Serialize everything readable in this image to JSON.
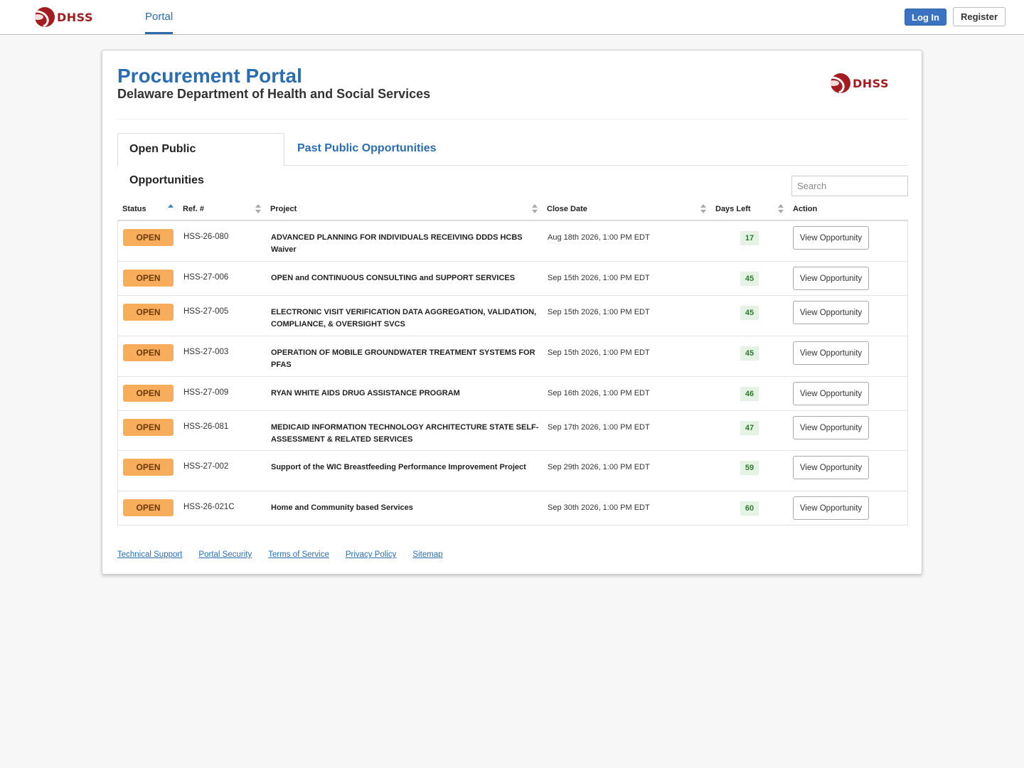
{
  "topnav": {
    "brand": "DHSS",
    "tab": "Portal",
    "login_label": "Log In",
    "register_label": "Register"
  },
  "header": {
    "title": "Procurement Portal",
    "subtitle": "Delaware Department of Health and Social Services",
    "brand": "DHSS"
  },
  "tabs": {
    "open": "Open Public Opportunities",
    "past": "Past Public Opportunities"
  },
  "search": {
    "placeholder": "Search"
  },
  "table": {
    "headers": {
      "status": "Status",
      "ref": "Ref. #",
      "project": "Project",
      "close_date": "Close Date",
      "days_left": "Days Left",
      "action": "Action"
    },
    "rows": [
      {
        "status": "OPEN",
        "ref": "HSS-26-080",
        "project": "ADVANCED PLANNING FOR INDIVIDUALS RECEIVING DDDS HCBS Waiver",
        "close_date": "Aug 18th 2026, 1:00 PM EDT",
        "days_left": "17",
        "action": "View Opportunity"
      },
      {
        "status": "OPEN",
        "ref": "HSS-27-006",
        "project": "OPEN and CONTINUOUS CONSULTING and SUPPORT SERVICES",
        "close_date": "Sep 15th 2026, 1:00 PM EDT",
        "days_left": "45",
        "action": "View Opportunity"
      },
      {
        "status": "OPEN",
        "ref": "HSS-27-005",
        "project": "ELECTRONIC VISIT VERIFICATION DATA AGGREGATION, VALIDATION, COMPLIANCE, & OVERSIGHT SVCS",
        "close_date": "Sep 15th 2026, 1:00 PM EDT",
        "days_left": "45",
        "action": "View Opportunity"
      },
      {
        "status": "OPEN",
        "ref": "HSS-27-003",
        "project": "OPERATION OF MOBILE GROUNDWATER TREATMENT SYSTEMS FOR PFAS",
        "close_date": "Sep 15th 2026, 1:00 PM EDT",
        "days_left": "45",
        "action": "View Opportunity"
      },
      {
        "status": "OPEN",
        "ref": "HSS-27-009",
        "project": "RYAN WHITE AIDS DRUG ASSISTANCE PROGRAM",
        "close_date": "Sep 16th 2026, 1:00 PM EDT",
        "days_left": "46",
        "action": "View Opportunity"
      },
      {
        "status": "OPEN",
        "ref": "HSS-26-081",
        "project": "MEDICAID INFORMATION TECHNOLOGY ARCHITECTURE STATE SELF-ASSESSMENT & RELATED SERVICES",
        "close_date": "Sep 17th 2026, 1:00 PM EDT",
        "days_left": "47",
        "action": "View Opportunity"
      },
      {
        "status": "OPEN",
        "ref": "HSS-27-002",
        "project": "Support of the WIC Breastfeeding Performance Improvement Project",
        "close_date": "Sep 29th 2026, 1:00 PM EDT",
        "days_left": "59",
        "action": "View Opportunity"
      },
      {
        "status": "OPEN",
        "ref": "HSS-26-021C",
        "project": "Home and Community based Services",
        "close_date": "Sep 30th 2026, 1:00 PM EDT",
        "days_left": "60",
        "action": "View Opportunity"
      }
    ]
  },
  "footer": {
    "links": [
      "Technical Support",
      "Portal Security",
      "Terms of Service",
      "Privacy Policy",
      "Sitemap"
    ]
  },
  "colors": {
    "accent": "#2a6db0",
    "brand_red": "#a51c20",
    "open_badge": "#f8ad5d",
    "days_left_bg": "#e4f3e3"
  }
}
